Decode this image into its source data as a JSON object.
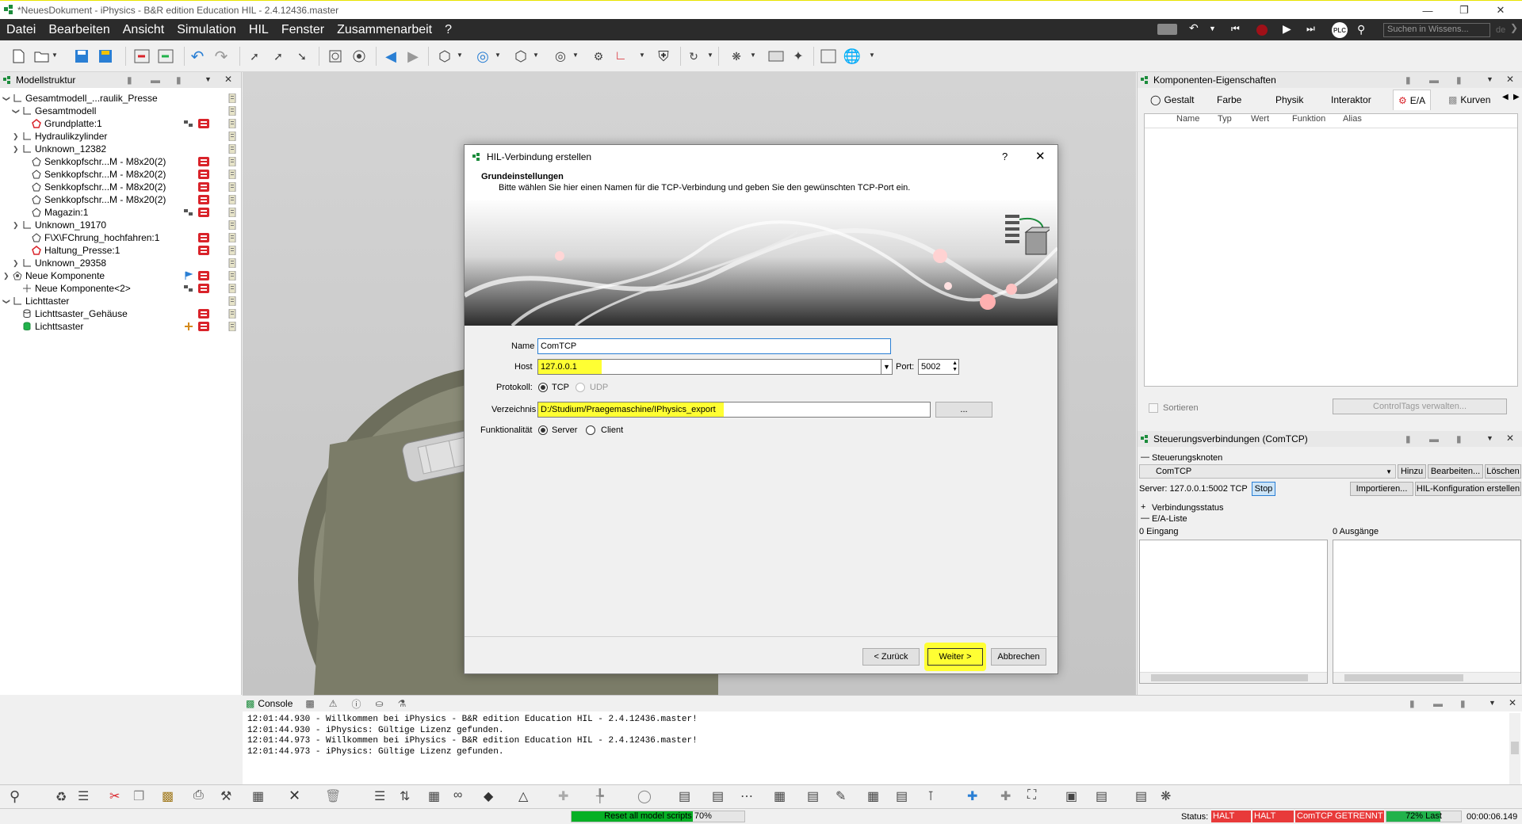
{
  "window": {
    "title": "*NeuesDokument - iPhysics - B&R edition Education HIL - 2.4.12436.master"
  },
  "menu": [
    "Datei",
    "Bearbeiten",
    "Ansicht",
    "Simulation",
    "HIL",
    "Fenster",
    "Zusammenarbeit",
    "?"
  ],
  "search": {
    "placeholder": "Suchen in Wissens..."
  },
  "plc_label": "PLC",
  "lang": "de",
  "tree": {
    "title": "Modellstruktur",
    "items": [
      {
        "label": "Gesamtmodell_...raulik_Presse",
        "icon": "axis-icon"
      },
      {
        "label": "Gesamtmodell",
        "icon": "axis-icon"
      },
      {
        "label": "Grundplatte:1",
        "icon": "warn-shape-icon"
      },
      {
        "label": "Hydraulikzylinder",
        "icon": "axis-icon"
      },
      {
        "label": "Unknown_12382",
        "icon": "axis-icon"
      },
      {
        "label": "Senkkopfschr...M - M8x20(2)",
        "icon": "shape-icon"
      },
      {
        "label": "Senkkopfschr...M - M8x20(2)",
        "icon": "shape-icon"
      },
      {
        "label": "Senkkopfschr...M - M8x20(2)",
        "icon": "shape-icon"
      },
      {
        "label": "Senkkopfschr...M - M8x20(2)",
        "icon": "shape-icon"
      },
      {
        "label": "Magazin:1",
        "icon": "shape-icon"
      },
      {
        "label": "Unknown_19170",
        "icon": "axis-icon"
      },
      {
        "label": "F\\X\\FChrung_hochfahren:1",
        "icon": "shape-icon"
      },
      {
        "label": "Haltung_Presse:1",
        "icon": "warn-shape-icon"
      },
      {
        "label": "Unknown_29358",
        "icon": "axis-icon"
      },
      {
        "label": "Neue Komponente",
        "icon": "gear-shape-icon"
      },
      {
        "label": "Neue Komponente<2>",
        "icon": "plus-icon"
      },
      {
        "label": "Lichttaster",
        "icon": "axis-icon"
      },
      {
        "label": "Lichttsaster_Gehäuse",
        "icon": "cylinder-icon"
      },
      {
        "label": "Lichttsaster",
        "icon": "green-cylinder-icon"
      }
    ]
  },
  "dialog": {
    "title": "HIL-Verbindung erstellen",
    "help": "?",
    "close": "✕",
    "heading": "Grundeinstellungen",
    "subtitle": "Bitte wählen Sie hier einen Namen für die TCP-Verbindung und geben Sie den gewünschten TCP-Port ein.",
    "name_label": "Name",
    "name_value": "ComTCP",
    "host_label": "Host",
    "host_value": "127.0.0.1",
    "port_label": "Port:",
    "port_value": "5002",
    "protocol_label": "Protokoll:",
    "tcp": "TCP",
    "udp": "UDP",
    "dir_label": "Verzeichnis",
    "dir_value": "D:/Studium/Praegemaschine/IPhysics_export",
    "browse": "...",
    "func_label": "Funktionalität",
    "server": "Server",
    "client": "Client",
    "back": "< Zurück",
    "next": "Weiter >",
    "cancel": "Abbrechen"
  },
  "props": {
    "title": "Komponenten-Eigenschaften",
    "tabs": [
      "Gestalt",
      "Farbe",
      "Physik",
      "Interaktor",
      "E/A",
      "Kurven"
    ],
    "columns": [
      "Name",
      "Typ",
      "Wert",
      "Funktion",
      "Alias"
    ],
    "sort": "Sortieren",
    "controltags": "ControlTags verwalten..."
  },
  "control": {
    "title": "Steuerungsverbindungen (ComTCP)",
    "nodes": "Steuerungsknoten",
    "selected": "ComTCP",
    "add": "Hinzu",
    "edit": "Bearbeiten...",
    "delete": "Löschen",
    "server": "Server: 127.0.0.1:5002 TCP",
    "stop": "Stop",
    "import": "Importieren...",
    "hilconfig": "HIL-Konfiguration erstellen",
    "status": "Verbindungsstatus",
    "ealist": "E/A-Liste",
    "inputs": "0 Eingang",
    "outputs": "0 Ausgänge"
  },
  "console": {
    "tab": "Console",
    "lines": [
      "12:01:44.930 - Willkommen bei iPhysics - B&R edition Education HIL - 2.4.12436.master!",
      "12:01:44.930 - iPhysics: Gültige Lizenz gefunden.",
      "12:01:44.973 - Willkommen bei iPhysics - B&R edition Education HIL - 2.4.12436.master!",
      "12:01:44.973 - iPhysics: Gültige Lizenz gefunden."
    ]
  },
  "status": {
    "progress_text": "Reset all model scripts 70%",
    "progress": 0.7,
    "label": "Status:",
    "halt1": "HALT",
    "halt2": "HALT",
    "comtcp": "ComTCP GETRENNT",
    "last": "72% Last",
    "last_value": 0.72,
    "time": "00:00:06.149"
  },
  "colors": {
    "accent_red": "#d9232a",
    "halt_red": "#e83a3a",
    "green": "#21b24b",
    "yellow": "#ffff33"
  }
}
